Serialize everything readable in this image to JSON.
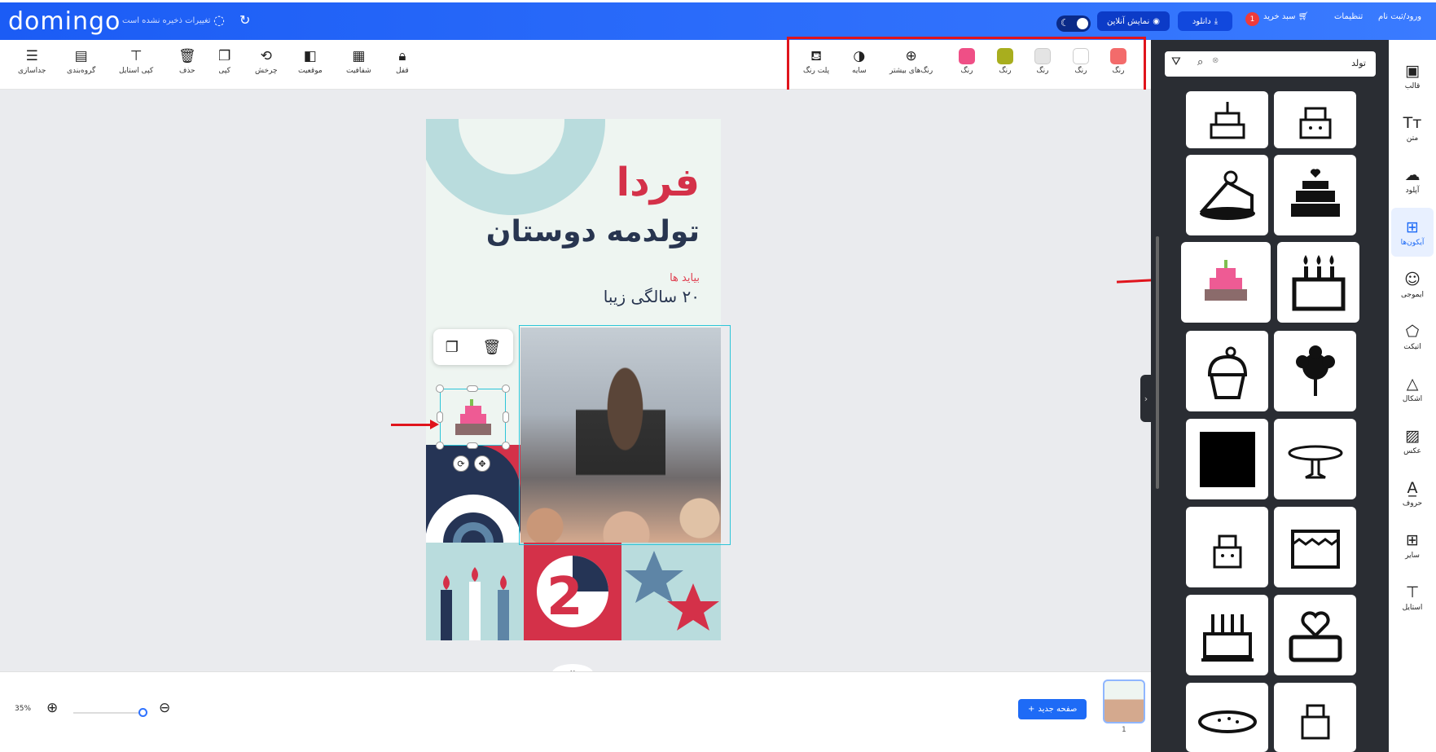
{
  "header": {
    "logo": "domingo",
    "unsaved": "تغییرات ذخیره نشده است",
    "login": "ورود/ثبت نام",
    "settings": "تنظیمات",
    "cart": "سبد خرید",
    "cart_count": "1",
    "download": "دانلود",
    "online_preview": "نمایش آنلاین"
  },
  "toolbar": {
    "left_tools": [
      {
        "label": "جداسازی",
        "icon": "ungroup-icon"
      },
      {
        "label": "گروه‌بندی",
        "icon": "group-icon"
      },
      {
        "label": "کپی استایل",
        "icon": "paint-roller-icon"
      },
      {
        "label": "حذف",
        "icon": "trash-icon"
      },
      {
        "label": "کپی",
        "icon": "copy-icon"
      },
      {
        "label": "چرخش",
        "icon": "rotate-icon"
      },
      {
        "label": "موقعیت",
        "icon": "layers-icon"
      },
      {
        "label": "شفافیت",
        "icon": "transparency-icon"
      },
      {
        "label": "قفل",
        "icon": "lock-icon"
      }
    ],
    "color_tools": {
      "palette": "پلت رنگ",
      "shadow": "سایه",
      "more_colors": "رنگ‌های بیشتر",
      "swatch_label": "رنگ",
      "swatches": [
        "#ef4f86",
        "#a8ae1e",
        "#e4e4e4",
        "#ffffff",
        "#f36b6b"
      ]
    }
  },
  "design": {
    "title1": "فردا",
    "title2": "تولدمه دوستان",
    "sub1": "بیاید ها",
    "sub2": "۲۰ سالگی زیبا"
  },
  "footer": {
    "zoom": "35%",
    "zoom_level": 0.35,
    "new_page": "صفحه جدید",
    "page_number": "1"
  },
  "panel": {
    "search_value": "تولد",
    "icons": [
      "cake-tiered-outline-icon",
      "cake-face-outline-icon",
      "cake-slice-icon",
      "cake-heart-icon",
      "cake-colored-icon",
      "cake-candles-icon",
      "cupcake-icon",
      "flower-icon",
      "black-square-icon",
      "cake-stand-icon",
      "cake-small-face-icon",
      "cake-box-icon",
      "cake-birthday-icon",
      "cake-heart-topper-icon",
      "pie-icon",
      "cake-small-icon"
    ]
  },
  "rail": [
    {
      "label": "قالب",
      "icon": "template-icon"
    },
    {
      "label": "متن",
      "icon": "text-icon"
    },
    {
      "label": "آپلود",
      "icon": "upload-icon"
    },
    {
      "label": "آیکون‌ها",
      "icon": "grid-icon"
    },
    {
      "label": "ایموجی",
      "icon": "emoji-icon"
    },
    {
      "label": "اتیکت",
      "icon": "tag-icon"
    },
    {
      "label": "اشکال",
      "icon": "shapes-icon"
    },
    {
      "label": "عکس",
      "icon": "image-icon"
    },
    {
      "label": "حروف",
      "icon": "letter-icon"
    },
    {
      "label": "سایر",
      "icon": "more-icon"
    },
    {
      "label": "استایل",
      "icon": "style-icon"
    }
  ]
}
